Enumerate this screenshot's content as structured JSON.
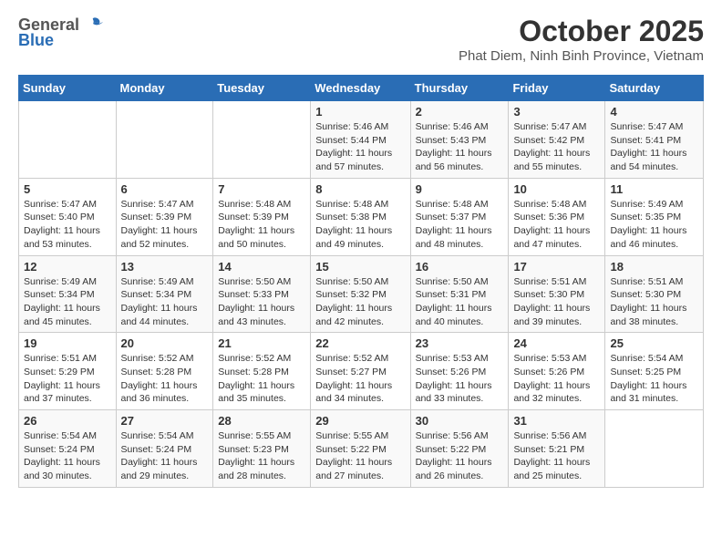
{
  "logo": {
    "general": "General",
    "blue": "Blue"
  },
  "title": "October 2025",
  "subtitle": "Phat Diem, Ninh Binh Province, Vietnam",
  "days_of_week": [
    "Sunday",
    "Monday",
    "Tuesday",
    "Wednesday",
    "Thursday",
    "Friday",
    "Saturday"
  ],
  "weeks": [
    [
      {
        "day": "",
        "info": ""
      },
      {
        "day": "",
        "info": ""
      },
      {
        "day": "",
        "info": ""
      },
      {
        "day": "1",
        "info": "Sunrise: 5:46 AM\nSunset: 5:44 PM\nDaylight: 11 hours\nand 57 minutes."
      },
      {
        "day": "2",
        "info": "Sunrise: 5:46 AM\nSunset: 5:43 PM\nDaylight: 11 hours\nand 56 minutes."
      },
      {
        "day": "3",
        "info": "Sunrise: 5:47 AM\nSunset: 5:42 PM\nDaylight: 11 hours\nand 55 minutes."
      },
      {
        "day": "4",
        "info": "Sunrise: 5:47 AM\nSunset: 5:41 PM\nDaylight: 11 hours\nand 54 minutes."
      }
    ],
    [
      {
        "day": "5",
        "info": "Sunrise: 5:47 AM\nSunset: 5:40 PM\nDaylight: 11 hours\nand 53 minutes."
      },
      {
        "day": "6",
        "info": "Sunrise: 5:47 AM\nSunset: 5:39 PM\nDaylight: 11 hours\nand 52 minutes."
      },
      {
        "day": "7",
        "info": "Sunrise: 5:48 AM\nSunset: 5:39 PM\nDaylight: 11 hours\nand 50 minutes."
      },
      {
        "day": "8",
        "info": "Sunrise: 5:48 AM\nSunset: 5:38 PM\nDaylight: 11 hours\nand 49 minutes."
      },
      {
        "day": "9",
        "info": "Sunrise: 5:48 AM\nSunset: 5:37 PM\nDaylight: 11 hours\nand 48 minutes."
      },
      {
        "day": "10",
        "info": "Sunrise: 5:48 AM\nSunset: 5:36 PM\nDaylight: 11 hours\nand 47 minutes."
      },
      {
        "day": "11",
        "info": "Sunrise: 5:49 AM\nSunset: 5:35 PM\nDaylight: 11 hours\nand 46 minutes."
      }
    ],
    [
      {
        "day": "12",
        "info": "Sunrise: 5:49 AM\nSunset: 5:34 PM\nDaylight: 11 hours\nand 45 minutes."
      },
      {
        "day": "13",
        "info": "Sunrise: 5:49 AM\nSunset: 5:34 PM\nDaylight: 11 hours\nand 44 minutes."
      },
      {
        "day": "14",
        "info": "Sunrise: 5:50 AM\nSunset: 5:33 PM\nDaylight: 11 hours\nand 43 minutes."
      },
      {
        "day": "15",
        "info": "Sunrise: 5:50 AM\nSunset: 5:32 PM\nDaylight: 11 hours\nand 42 minutes."
      },
      {
        "day": "16",
        "info": "Sunrise: 5:50 AM\nSunset: 5:31 PM\nDaylight: 11 hours\nand 40 minutes."
      },
      {
        "day": "17",
        "info": "Sunrise: 5:51 AM\nSunset: 5:30 PM\nDaylight: 11 hours\nand 39 minutes."
      },
      {
        "day": "18",
        "info": "Sunrise: 5:51 AM\nSunset: 5:30 PM\nDaylight: 11 hours\nand 38 minutes."
      }
    ],
    [
      {
        "day": "19",
        "info": "Sunrise: 5:51 AM\nSunset: 5:29 PM\nDaylight: 11 hours\nand 37 minutes."
      },
      {
        "day": "20",
        "info": "Sunrise: 5:52 AM\nSunset: 5:28 PM\nDaylight: 11 hours\nand 36 minutes."
      },
      {
        "day": "21",
        "info": "Sunrise: 5:52 AM\nSunset: 5:28 PM\nDaylight: 11 hours\nand 35 minutes."
      },
      {
        "day": "22",
        "info": "Sunrise: 5:52 AM\nSunset: 5:27 PM\nDaylight: 11 hours\nand 34 minutes."
      },
      {
        "day": "23",
        "info": "Sunrise: 5:53 AM\nSunset: 5:26 PM\nDaylight: 11 hours\nand 33 minutes."
      },
      {
        "day": "24",
        "info": "Sunrise: 5:53 AM\nSunset: 5:26 PM\nDaylight: 11 hours\nand 32 minutes."
      },
      {
        "day": "25",
        "info": "Sunrise: 5:54 AM\nSunset: 5:25 PM\nDaylight: 11 hours\nand 31 minutes."
      }
    ],
    [
      {
        "day": "26",
        "info": "Sunrise: 5:54 AM\nSunset: 5:24 PM\nDaylight: 11 hours\nand 30 minutes."
      },
      {
        "day": "27",
        "info": "Sunrise: 5:54 AM\nSunset: 5:24 PM\nDaylight: 11 hours\nand 29 minutes."
      },
      {
        "day": "28",
        "info": "Sunrise: 5:55 AM\nSunset: 5:23 PM\nDaylight: 11 hours\nand 28 minutes."
      },
      {
        "day": "29",
        "info": "Sunrise: 5:55 AM\nSunset: 5:22 PM\nDaylight: 11 hours\nand 27 minutes."
      },
      {
        "day": "30",
        "info": "Sunrise: 5:56 AM\nSunset: 5:22 PM\nDaylight: 11 hours\nand 26 minutes."
      },
      {
        "day": "31",
        "info": "Sunrise: 5:56 AM\nSunset: 5:21 PM\nDaylight: 11 hours\nand 25 minutes."
      },
      {
        "day": "",
        "info": ""
      }
    ]
  ]
}
